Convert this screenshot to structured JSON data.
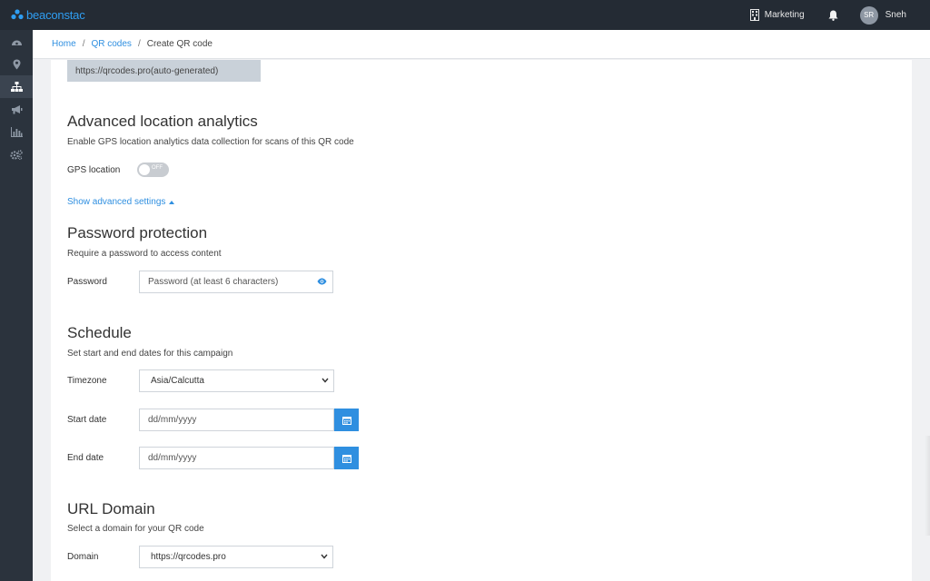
{
  "app": {
    "brand": "beaconstac",
    "org": "Marketing",
    "user_initials": "SR",
    "user_name": "Sneh",
    "accent": "#2f8fe0"
  },
  "sidebar": {
    "items": [
      {
        "icon": "dashboard-icon"
      },
      {
        "icon": "location-pin-icon"
      },
      {
        "icon": "sitemap-icon",
        "active": true
      },
      {
        "icon": "megaphone-icon"
      },
      {
        "icon": "bar-chart-icon"
      },
      {
        "icon": "gears-icon"
      }
    ]
  },
  "breadcrumb": {
    "home": "Home",
    "qr_codes": "QR codes",
    "current": "Create QR code",
    "separator": "/"
  },
  "url_box": "https://qrcodes.pro(auto-generated)",
  "location": {
    "title": "Advanced location analytics",
    "description": "Enable GPS location analytics data collection for scans of this QR code",
    "gps_label": "GPS location",
    "toggle_state": "OFF"
  },
  "advanced_link": "Show advanced settings",
  "password": {
    "title": "Password protection",
    "description": "Require a password to access content",
    "label": "Password",
    "placeholder": "Password (at least 6 characters)"
  },
  "schedule": {
    "title": "Schedule",
    "description": "Set start and end dates for this campaign",
    "timezone_label": "Timezone",
    "timezone_value": "Asia/Calcutta",
    "start_label": "Start date",
    "start_placeholder": "dd/mm/yyyy",
    "end_label": "End date",
    "end_placeholder": "dd/mm/yyyy"
  },
  "domain": {
    "title": "URL Domain",
    "description": "Select a domain for your QR code",
    "label": "Domain",
    "value": "https://qrcodes.pro"
  }
}
